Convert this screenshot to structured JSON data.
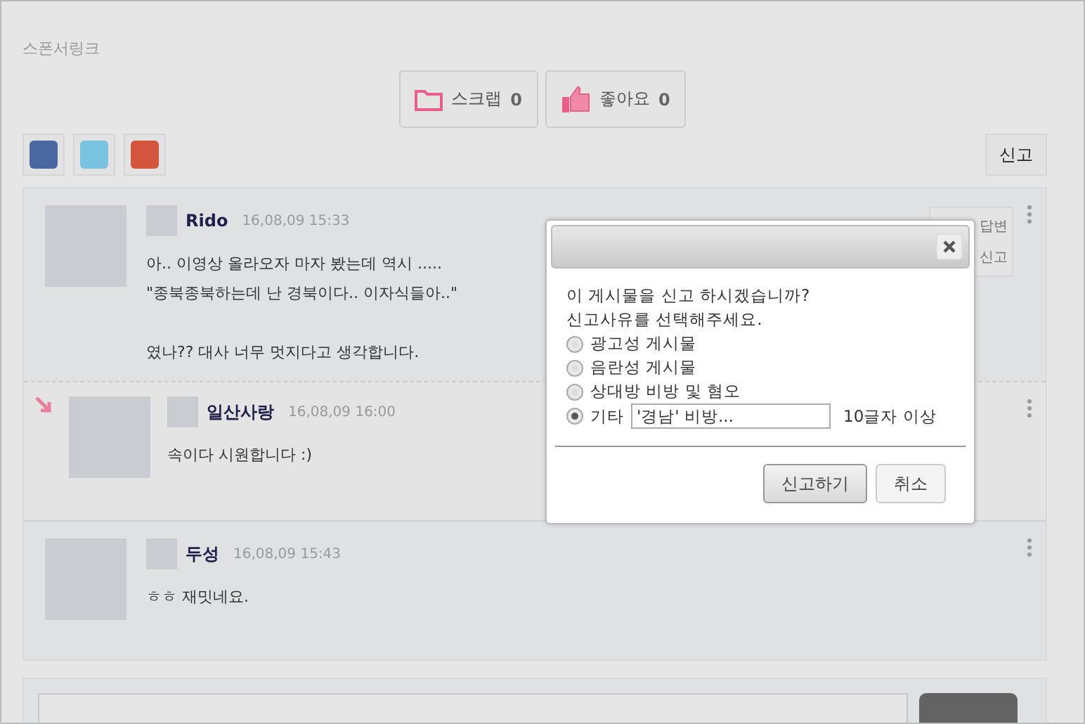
{
  "sponsor_label": "스폰서링크",
  "actions": [
    {
      "kind": "scrap",
      "label": "스크랩",
      "count": "0"
    },
    {
      "kind": "like",
      "label": "좋아요",
      "count": "0"
    }
  ],
  "share": [
    {
      "kind": "facebook"
    },
    {
      "kind": "twitter"
    },
    {
      "kind": "googleplus"
    }
  ],
  "report_button": "신고",
  "comments": [
    {
      "author": "Rido",
      "time": "16,08,09 15:33",
      "paragraphs": [
        [
          "아.. 이영상 올라오자 마자 봤는데 역시 .....",
          "\"종북종북하는데 난 경북이다.. 이자식들아..\""
        ],
        [
          "였나?? 대사 너무 멋지다고 생각합니다."
        ]
      ],
      "reply": false
    },
    {
      "author": "일산사랑",
      "time": "16,08,09 16:00",
      "paragraphs": [
        [
          "속이다 시원합니다 :)"
        ]
      ],
      "reply": true
    },
    {
      "author": "두성",
      "time": "16,08,09 15:43",
      "paragraphs": [
        [
          "ㅎㅎ 재밋네요."
        ]
      ],
      "reply": false
    }
  ],
  "comment_menu": [
    "답변",
    "신고"
  ],
  "dialog": {
    "question": "이 게시물을 신고 하시겠습니까?",
    "instruction": "신고사유를 선택해주세요.",
    "reasons": [
      {
        "label": "광고성 게시물",
        "selected": false,
        "kind": "plain"
      },
      {
        "label": "음란성 게시물",
        "selected": false,
        "kind": "plain"
      },
      {
        "label": "상대방 비방 및 혐오",
        "selected": false,
        "kind": "plain"
      },
      {
        "label": "기타",
        "selected": true,
        "kind": "other",
        "value": "'경남' 비방...",
        "hint": "10글자 이상"
      }
    ],
    "buttons": [
      {
        "label": "신고하기",
        "primary": true
      },
      {
        "label": "취소",
        "primary": false
      }
    ]
  }
}
